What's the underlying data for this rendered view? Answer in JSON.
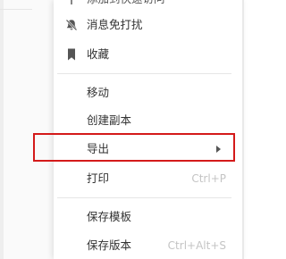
{
  "menu": {
    "top_partial_item": {
      "label": "添加到快速访问",
      "icon": "pin-icon"
    },
    "mute_item": {
      "label": "消息免打扰",
      "icon": "bell-mute-icon"
    },
    "favorite_item": {
      "label": "收藏",
      "icon": "bookmark-icon"
    },
    "move_item": {
      "label": "移动"
    },
    "copy_item": {
      "label": "创建副本"
    },
    "export_item": {
      "label": "导出",
      "has_submenu": true
    },
    "print_item": {
      "label": "打印",
      "shortcut": "Ctrl+P"
    },
    "template_item": {
      "label": "保存模板"
    },
    "version_item": {
      "label": "保存版本",
      "shortcut": "Ctrl+Alt+S"
    }
  },
  "highlight": {
    "target": "导出",
    "color": "#d41a1a"
  }
}
